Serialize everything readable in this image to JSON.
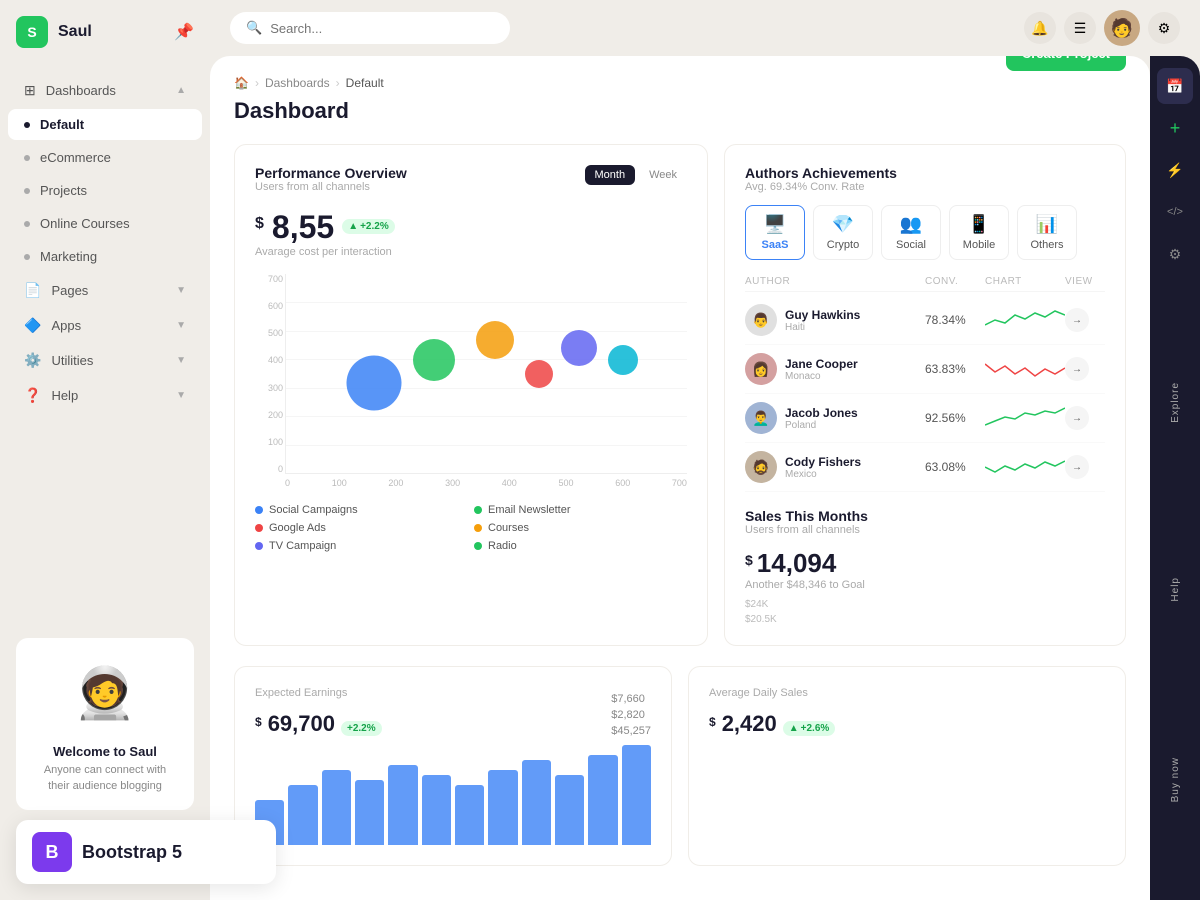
{
  "app": {
    "name": "Saul",
    "logo_letter": "S"
  },
  "sidebar": {
    "items": [
      {
        "id": "dashboards",
        "label": "Dashboards",
        "icon": "⊞",
        "hasChevron": true,
        "active": false,
        "type": "icon"
      },
      {
        "id": "default",
        "label": "Default",
        "active": true,
        "type": "dot"
      },
      {
        "id": "ecommerce",
        "label": "eCommerce",
        "active": false,
        "type": "dot"
      },
      {
        "id": "projects",
        "label": "Projects",
        "active": false,
        "type": "dot"
      },
      {
        "id": "online-courses",
        "label": "Online Courses",
        "active": false,
        "type": "dot"
      },
      {
        "id": "marketing",
        "label": "Marketing",
        "active": false,
        "type": "dot"
      },
      {
        "id": "pages",
        "label": "Pages",
        "icon": "📄",
        "hasChevron": true,
        "active": false,
        "type": "icon"
      },
      {
        "id": "apps",
        "label": "Apps",
        "icon": "🔷",
        "hasChevron": true,
        "active": false,
        "type": "icon"
      },
      {
        "id": "utilities",
        "label": "Utilities",
        "icon": "⚙️",
        "hasChevron": true,
        "active": false,
        "type": "icon"
      },
      {
        "id": "help",
        "label": "Help",
        "icon": "❓",
        "hasChevron": true,
        "active": false,
        "type": "icon"
      }
    ],
    "welcome": {
      "title": "Welcome to Saul",
      "subtitle": "Anyone can connect with their audience blogging"
    }
  },
  "topbar": {
    "search_placeholder": "Search...",
    "search_label": "Search _"
  },
  "breadcrumb": {
    "home": "🏠",
    "section": "Dashboards",
    "current": "Default"
  },
  "page": {
    "title": "Dashboard",
    "create_btn": "Create Project"
  },
  "performance": {
    "title": "Performance Overview",
    "subtitle": "Users from all channels",
    "period_month": "Month",
    "period_week": "Week",
    "value": "8,55",
    "currency": "$",
    "badge": "+2.2%",
    "label": "Avarage cost per interaction",
    "y_labels": [
      "700",
      "600",
      "500",
      "400",
      "300",
      "200",
      "100",
      "0"
    ],
    "x_labels": [
      "0",
      "100",
      "200",
      "300",
      "400",
      "500",
      "600",
      "700"
    ],
    "bubbles": [
      {
        "x": 22,
        "y": 55,
        "size": 55,
        "color": "#3b82f6"
      },
      {
        "x": 37,
        "y": 43,
        "size": 42,
        "color": "#22c55e"
      },
      {
        "x": 52,
        "y": 33,
        "size": 38,
        "color": "#f59e0b"
      },
      {
        "x": 63,
        "y": 47,
        "size": 28,
        "color": "#ef4444"
      },
      {
        "x": 73,
        "y": 37,
        "size": 36,
        "color": "#6366f1"
      },
      {
        "x": 84,
        "y": 43,
        "size": 30,
        "color": "#06b6d4"
      }
    ],
    "legend": [
      {
        "label": "Social Campaigns",
        "color": "#3b82f6"
      },
      {
        "label": "Email Newsletter",
        "color": "#22c55e"
      },
      {
        "label": "Google Ads",
        "color": "#ef4444"
      },
      {
        "label": "Courses",
        "color": "#f59e0b"
      },
      {
        "label": "TV Campaign",
        "color": "#6366f1"
      },
      {
        "label": "Radio",
        "color": "#22c55e"
      }
    ]
  },
  "authors": {
    "title": "Authors Achievements",
    "subtitle": "Avg. 69.34% Conv. Rate",
    "tabs": [
      {
        "id": "saas",
        "label": "SaaS",
        "icon": "🖥️",
        "active": true
      },
      {
        "id": "crypto",
        "label": "Crypto",
        "icon": "💎",
        "active": false
      },
      {
        "id": "social",
        "label": "Social",
        "icon": "👥",
        "active": false
      },
      {
        "id": "mobile",
        "label": "Mobile",
        "icon": "📱",
        "active": false
      },
      {
        "id": "others",
        "label": "Others",
        "icon": "📊",
        "active": false
      }
    ],
    "table_headers": {
      "author": "AUTHOR",
      "conv": "CONV.",
      "chart": "CHART",
      "view": "VIEW"
    },
    "authors": [
      {
        "name": "Guy Hawkins",
        "country": "Haiti",
        "conv": "78.34%",
        "avatar": "👨",
        "chart_color": "#22c55e"
      },
      {
        "name": "Jane Cooper",
        "country": "Monaco",
        "conv": "63.83%",
        "avatar": "👩",
        "chart_color": "#ef4444"
      },
      {
        "name": "Jacob Jones",
        "country": "Poland",
        "conv": "92.56%",
        "avatar": "👨‍🦱",
        "chart_color": "#22c55e"
      },
      {
        "name": "Cody Fishers",
        "country": "Mexico",
        "conv": "63.08%",
        "avatar": "🧔",
        "chart_color": "#22c55e"
      }
    ]
  },
  "earnings": {
    "title": "Expected Earnings",
    "value": "69,700",
    "currency": "$",
    "badge": "+2.2%",
    "bar_values": [
      40,
      55,
      70,
      60,
      75,
      65,
      55,
      70,
      80,
      65,
      75,
      90
    ],
    "side_labels": [
      "$7,660",
      "$2,820",
      "$45,257"
    ]
  },
  "daily_sales": {
    "title": "Average Daily Sales",
    "value": "2,420",
    "currency": "$",
    "badge": "+2.6%"
  },
  "sales_month": {
    "title": "Sales This Months",
    "subtitle": "Users from all channels",
    "value": "14,094",
    "currency": "$",
    "goal_text": "Another $48,346 to Goal",
    "y_labels": [
      "$24K",
      "$20.5K"
    ]
  },
  "right_panel": {
    "icons": [
      "📅",
      "➕",
      "⚡",
      "</>",
      "⚙️"
    ],
    "labels": [
      "Explore",
      "Help",
      "Buy now"
    ]
  },
  "bootstrap_badge": {
    "letter": "B",
    "label": "Bootstrap 5"
  }
}
